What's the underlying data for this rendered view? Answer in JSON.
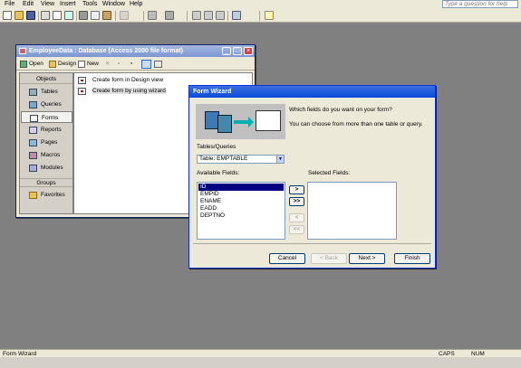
{
  "menu": {
    "items": [
      "File",
      "Edit",
      "View",
      "Insert",
      "Tools",
      "Window",
      "Help"
    ],
    "help_placeholder": "Type a question for help"
  },
  "db_window": {
    "title": "EmployeeData : Database (Access 2000 file format)",
    "toolbar": {
      "open": "Open",
      "design": "Design",
      "new": "New"
    },
    "objects_header": "Objects",
    "objects": [
      "Tables",
      "Queries",
      "Forms",
      "Reports",
      "Pages",
      "Macros",
      "Modules"
    ],
    "selected_object": "Forms",
    "groups_header": "Groups",
    "favorites": "Favorites",
    "content_items": [
      "Create form in Design view",
      "Create form by using wizard"
    ]
  },
  "wizard": {
    "title": "Form Wizard",
    "prompt": "Which fields do you want on your form?",
    "hint": "You can choose from more than one table or query.",
    "tables_label": "Tables/Queries",
    "table_value": "Table: EMPTABLE",
    "available_label": "Available Fields:",
    "selected_label": "Selected Fields:",
    "available_fields": [
      "ID",
      "EMPID",
      "ENAME",
      "EADD",
      "DEPTNO"
    ],
    "move_buttons": [
      ">",
      ">>",
      "<",
      "<<"
    ],
    "buttons": {
      "cancel": "Cancel",
      "back": "< Back",
      "next": "Next >",
      "finish": "Finish"
    }
  },
  "status": {
    "left": "Form Wizard",
    "caps": "CAPS",
    "num": "NUM"
  }
}
